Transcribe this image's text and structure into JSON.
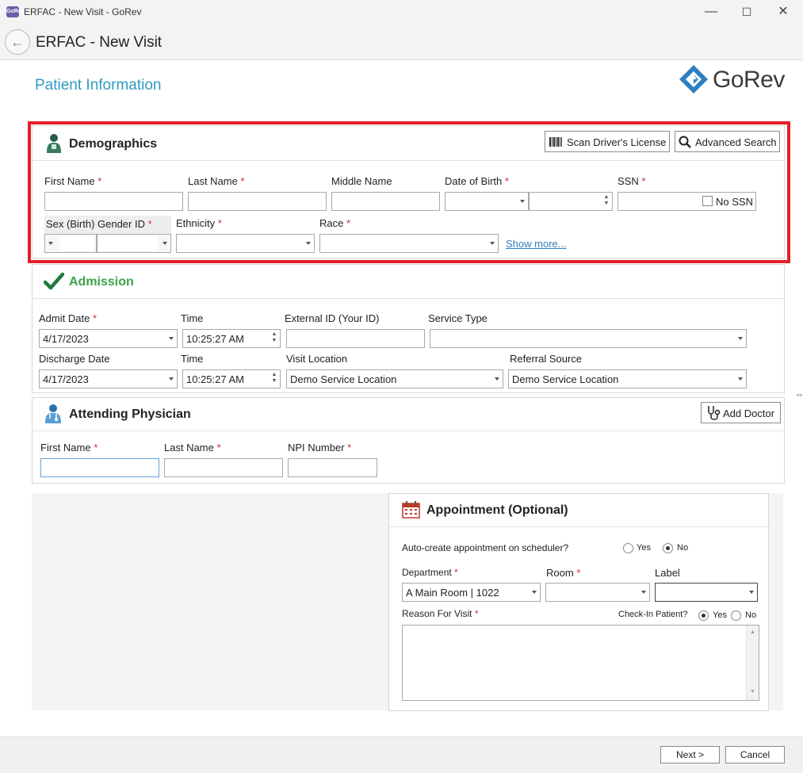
{
  "window": {
    "title": "ERFAC - New Visit - GoRev",
    "app_icon_text": "GoRev",
    "controls": {
      "minimize": "—",
      "maximize": "☐",
      "close": "✕"
    }
  },
  "header": {
    "title": "ERFAC - New Visit",
    "back_icon": "←"
  },
  "section_title": "Patient Information",
  "logo": {
    "text": "GoRev",
    "color": "#2f7fc0"
  },
  "demographics": {
    "title": "Demographics",
    "scan_button": "Scan Driver's License",
    "advanced_search_button": "Advanced Search",
    "labels": {
      "first_name": "First Name",
      "last_name": "Last Name",
      "middle_name": "Middle Name",
      "dob": "Date of Birth",
      "ssn": "SSN",
      "no_ssn": "No SSN",
      "sex_birth": "Sex (Birth)",
      "gender_id": "Gender ID",
      "ethnicity": "Ethnicity",
      "race": "Race"
    },
    "show_more": "Show more..."
  },
  "admission": {
    "title": "Admission",
    "labels": {
      "admit_date": "Admit Date",
      "time": "Time",
      "external_id": "External ID (Your ID)",
      "service_type": "Service Type",
      "discharge_date": "Discharge Date",
      "visit_location": "Visit Location",
      "referral_source": "Referral Source"
    },
    "values": {
      "admit_date": "4/17/2023",
      "admit_time": "10:25:27 AM",
      "discharge_date": "4/17/2023",
      "discharge_time": "10:25:27 AM",
      "visit_location": "Demo Service Location",
      "referral_source": "Demo Service Location"
    }
  },
  "physician": {
    "title": "Attending Physician",
    "add_doctor_button": "Add Doctor",
    "labels": {
      "first_name": "First Name",
      "last_name": "Last Name",
      "npi": "NPI Number"
    }
  },
  "appointment": {
    "title": "Appointment (Optional)",
    "auto_create_label": "Auto-create appointment on scheduler?",
    "yes": "Yes",
    "no": "No",
    "department_label": "Department",
    "department_value": "A Main Room | 1022",
    "room_label": "Room",
    "label_label": "Label",
    "reason_label": "Reason For Visit",
    "checkin_label": "Check-In Patient?"
  },
  "footer": {
    "next_button": "Next >",
    "cancel_button": "Cancel"
  },
  "colors": {
    "accent": "#2f9bc1",
    "admission_green": "#3aa04a",
    "highlight_red": "#e3202a"
  }
}
